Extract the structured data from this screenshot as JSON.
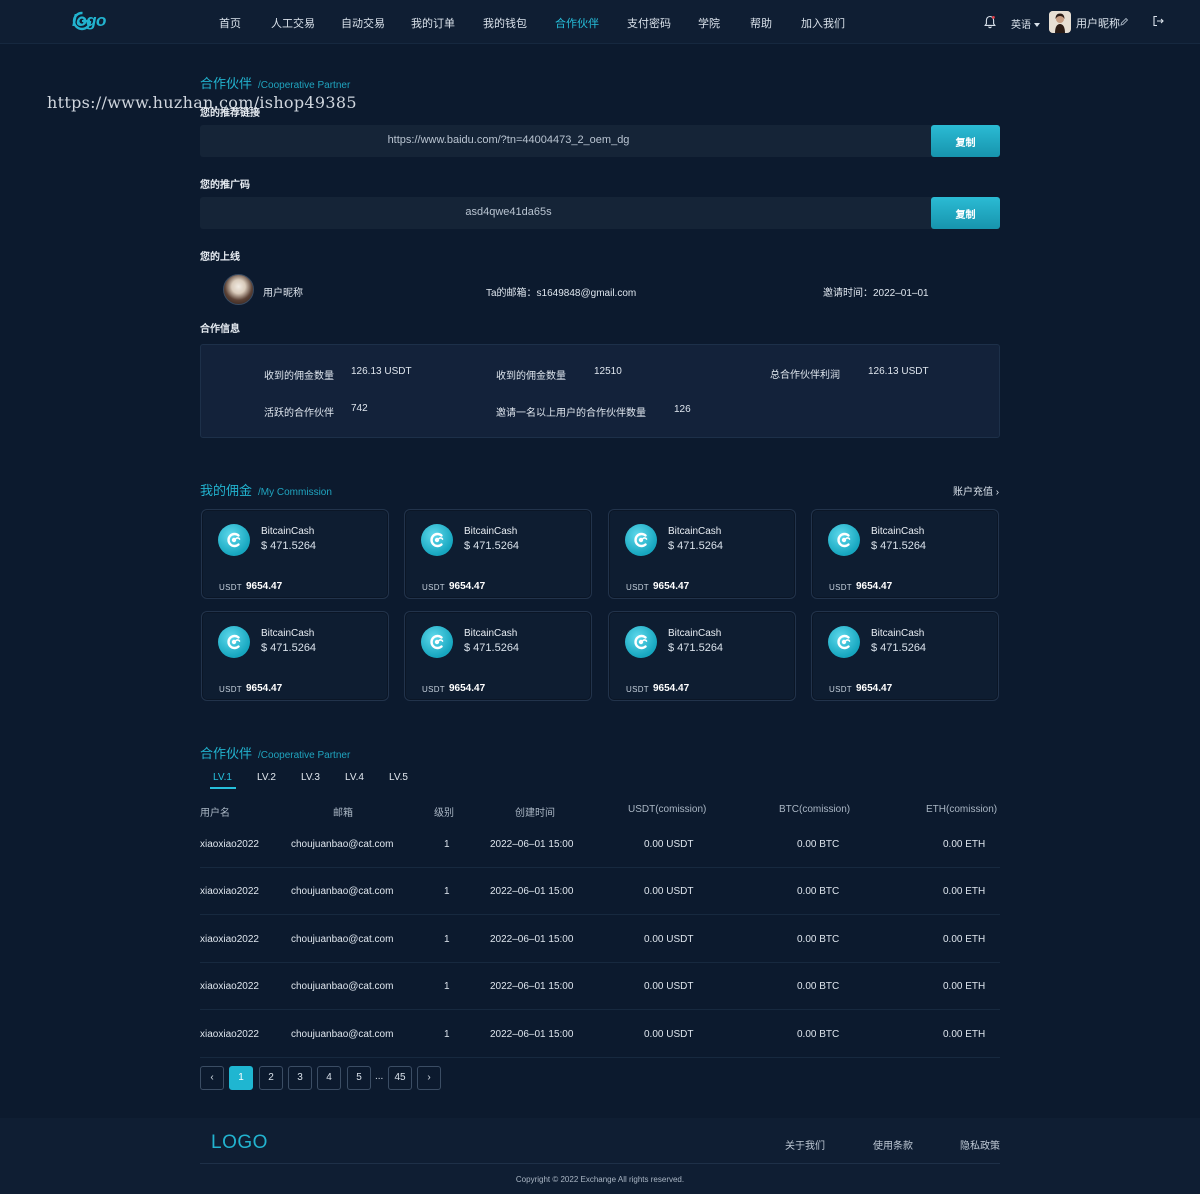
{
  "header": {
    "logo_text": "logo",
    "nav": [
      "首页",
      "人工交易",
      "自动交易",
      "我的订单",
      "我的钱包",
      "合作伙伴",
      "支付密码",
      "学院",
      "帮助",
      "加入我们"
    ],
    "active_nav": "合作伙伴",
    "language": "英语",
    "username": "用户昵称"
  },
  "watermark": "https://www.huzhan.com/ishop49385",
  "partner": {
    "title_cn": "合作伙伴",
    "title_en": "/Cooperative Partner",
    "link_label": "您的推荐链接",
    "link_value": "https://www.baidu.com/?tn=44004473_2_oem_dg",
    "copy_label": "复制",
    "code_label": "您的推广码",
    "code_value": "asd4qwe41da65s",
    "upline_label": "您的上线",
    "upline_name": "用户昵称",
    "upline_email": "Ta的邮箱：s1649848@gmail.com",
    "upline_time": "邀请时间：2022–01–01",
    "info_label": "合作信息",
    "info": {
      "received_comm_label": "收到的佣金数量",
      "received_comm_value": "126.13 USDT",
      "received_count_label": "收到的佣金数量",
      "received_count_value": "12510",
      "total_profit_label": "总合作伙伴利润",
      "total_profit_value": "126.13 USDT",
      "active_label": "活跃的合作伙伴",
      "active_value": "742",
      "invite_label": "邀请一名以上用户的合作伙伴数量",
      "invite_value": "126"
    }
  },
  "commission": {
    "title_cn": "我的佣金",
    "title_en": "/My Commission",
    "recharge": "账户充值",
    "cards": [
      {
        "name": "BitcainCash",
        "price": "$ 471.5264",
        "unit": "USDT",
        "amount": "9654.47"
      },
      {
        "name": "BitcainCash",
        "price": "$ 471.5264",
        "unit": "USDT",
        "amount": "9654.47"
      },
      {
        "name": "BitcainCash",
        "price": "$ 471.5264",
        "unit": "USDT",
        "amount": "9654.47"
      },
      {
        "name": "BitcainCash",
        "price": "$ 471.5264",
        "unit": "USDT",
        "amount": "9654.47"
      },
      {
        "name": "BitcainCash",
        "price": "$ 471.5264",
        "unit": "USDT",
        "amount": "9654.47"
      },
      {
        "name": "BitcainCash",
        "price": "$ 471.5264",
        "unit": "USDT",
        "amount": "9654.47"
      },
      {
        "name": "BitcainCash",
        "price": "$ 471.5264",
        "unit": "USDT",
        "amount": "9654.47"
      },
      {
        "name": "BitcainCash",
        "price": "$ 471.5264",
        "unit": "USDT",
        "amount": "9654.47"
      }
    ]
  },
  "partners_table": {
    "title_cn": "合作伙伴",
    "title_en": "/Cooperative Partner",
    "tabs": [
      "LV.1",
      "LV.2",
      "LV.3",
      "LV.4",
      "LV.5"
    ],
    "active_tab": "LV.1",
    "columns": [
      "用户名",
      "邮箱",
      "级别",
      "创建时间",
      "USDT(comission)",
      "BTC(comission)",
      "ETH(comission)"
    ],
    "rows": [
      [
        "xiaoxiao2022",
        "choujuanbao@cat.com",
        "1",
        "2022–06–01 15:00",
        "0.00 USDT",
        "0.00 BTC",
        "0.00 ETH"
      ],
      [
        "xiaoxiao2022",
        "choujuanbao@cat.com",
        "1",
        "2022–06–01 15:00",
        "0.00 USDT",
        "0.00 BTC",
        "0.00 ETH"
      ],
      [
        "xiaoxiao2022",
        "choujuanbao@cat.com",
        "1",
        "2022–06–01 15:00",
        "0.00 USDT",
        "0.00 BTC",
        "0.00 ETH"
      ],
      [
        "xiaoxiao2022",
        "choujuanbao@cat.com",
        "1",
        "2022–06–01 15:00",
        "0.00 USDT",
        "0.00 BTC",
        "0.00 ETH"
      ],
      [
        "xiaoxiao2022",
        "choujuanbao@cat.com",
        "1",
        "2022–06–01 15:00",
        "0.00 USDT",
        "0.00 BTC",
        "0.00 ETH"
      ]
    ]
  },
  "pagination": {
    "pages": [
      "1",
      "2",
      "3",
      "4",
      "5"
    ],
    "ellipsis": "...",
    "last": "45",
    "current": "1"
  },
  "footer": {
    "logo": "LOGO",
    "links": [
      "关于我们",
      "使用条款",
      "隐私政策"
    ],
    "copyright": "Copyright © 2022 Exchange All rights reserved."
  },
  "colors": {
    "accent": "#22b3cf",
    "background": "#0c1a2e",
    "header": "#0f1e33"
  },
  "icons": [
    "logo-icon",
    "bell-icon",
    "caret-down-icon",
    "edit-icon",
    "logout-icon",
    "bitcoin-cash-icon",
    "chevron-right-icon",
    "chevron-left-icon"
  ]
}
